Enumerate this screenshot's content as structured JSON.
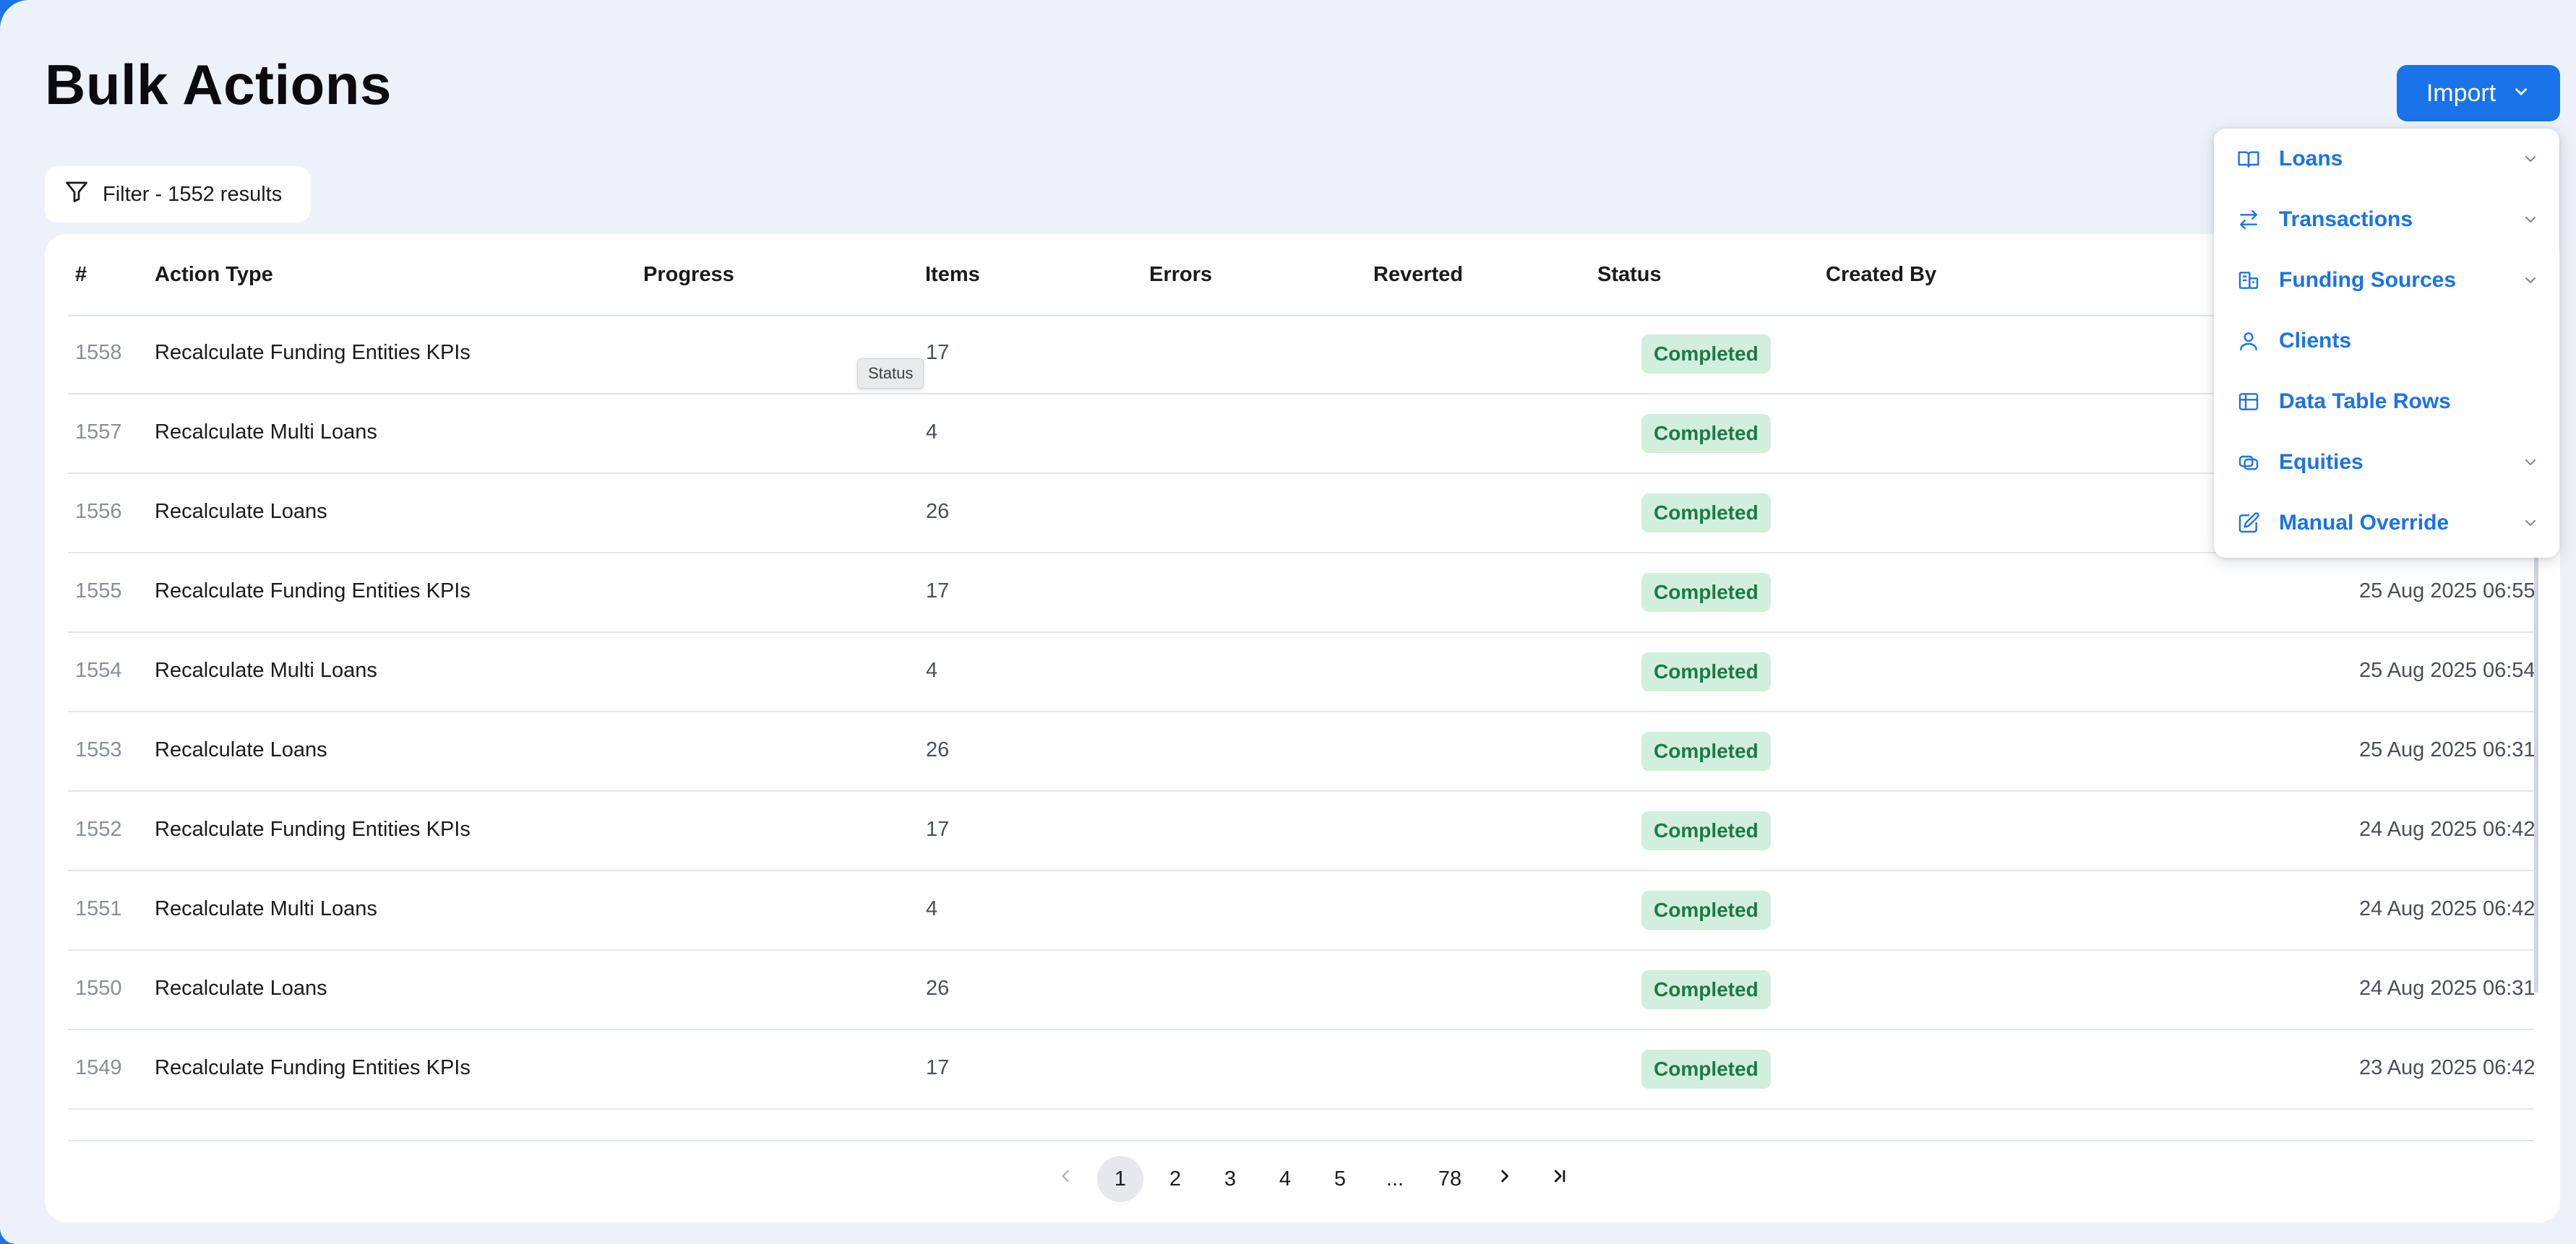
{
  "page": {
    "title": "Bulk Actions"
  },
  "import_button": {
    "label": "Import"
  },
  "filter": {
    "label": "Filter - 1552 results"
  },
  "table": {
    "headers": {
      "id": "#",
      "action_type": "Action Type",
      "progress": "Progress",
      "items": "Items",
      "errors": "Errors",
      "reverted": "Reverted",
      "status": "Status",
      "created_by": "Created By"
    },
    "rows": [
      {
        "id": "1558",
        "action_type": "Recalculate Funding Entities KPIs",
        "items": "17",
        "status": "Completed",
        "date": ""
      },
      {
        "id": "1557",
        "action_type": "Recalculate Multi Loans",
        "items": "4",
        "status": "Completed",
        "date": ""
      },
      {
        "id": "1556",
        "action_type": "Recalculate Loans",
        "items": "26",
        "status": "Completed",
        "date": ""
      },
      {
        "id": "1555",
        "action_type": "Recalculate Funding Entities KPIs",
        "items": "17",
        "status": "Completed",
        "date": "25 Aug 2025 06:55"
      },
      {
        "id": "1554",
        "action_type": "Recalculate Multi Loans",
        "items": "4",
        "status": "Completed",
        "date": "25 Aug 2025 06:54"
      },
      {
        "id": "1553",
        "action_type": "Recalculate Loans",
        "items": "26",
        "status": "Completed",
        "date": "25 Aug 2025 06:31"
      },
      {
        "id": "1552",
        "action_type": "Recalculate Funding Entities KPIs",
        "items": "17",
        "status": "Completed",
        "date": "24 Aug 2025 06:42"
      },
      {
        "id": "1551",
        "action_type": "Recalculate Multi Loans",
        "items": "4",
        "status": "Completed",
        "date": "24 Aug 2025 06:42"
      },
      {
        "id": "1550",
        "action_type": "Recalculate Loans",
        "items": "26",
        "status": "Completed",
        "date": "24 Aug 2025 06:31"
      },
      {
        "id": "1549",
        "action_type": "Recalculate Funding Entities KPIs",
        "items": "17",
        "status": "Completed",
        "date": "23 Aug 2025 06:42"
      }
    ]
  },
  "tooltip": {
    "text": "Status"
  },
  "pagination": {
    "pages": [
      "1",
      "2",
      "3",
      "4",
      "5",
      "...",
      "78"
    ],
    "current": "1"
  },
  "import_menu": {
    "items": [
      {
        "label": "Loans",
        "icon": "book-open-icon",
        "has_submenu": true
      },
      {
        "label": "Transactions",
        "icon": "arrows-swap-icon",
        "has_submenu": true
      },
      {
        "label": "Funding Sources",
        "icon": "funding-source-icon",
        "has_submenu": true
      },
      {
        "label": "Clients",
        "icon": "user-icon",
        "has_submenu": false
      },
      {
        "label": "Data Table Rows",
        "icon": "table-icon",
        "has_submenu": false
      },
      {
        "label": "Equities",
        "icon": "coins-icon",
        "has_submenu": true
      },
      {
        "label": "Manual Override",
        "icon": "edit-icon",
        "has_submenu": true
      }
    ]
  },
  "colors": {
    "accent": "#1a73e8",
    "background": "#edf2fa",
    "status_completed_bg": "#d2eedd",
    "status_completed_text": "#1c7a46"
  }
}
